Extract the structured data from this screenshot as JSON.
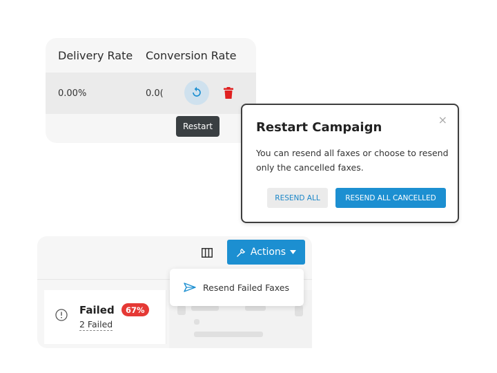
{
  "table": {
    "headers": [
      "Delivery Rate",
      "Conversion Rate"
    ],
    "row": {
      "delivery_rate": "0.00%",
      "conversion_rate": "0.0("
    },
    "restart_tooltip": "Restart",
    "icons": {
      "restart": "restart-icon",
      "delete": "trash-icon"
    },
    "delete_color": "#e02020"
  },
  "dialog": {
    "title": "Restart Campaign",
    "close": "×",
    "body": "You can resend all faxes or choose to resend only the cancelled faxes.",
    "buttons": {
      "resend_all": "RESEND ALL",
      "resend_all_cancelled": "RESEND ALL CANCELLED"
    },
    "accent_color": "#1c8fd1"
  },
  "toolbar": {
    "actions_label": "Actions",
    "icons": {
      "columns": "columns-icon",
      "actions": "tools-icon",
      "caret": "caret-down-icon"
    }
  },
  "dropdown": {
    "items": [
      {
        "label": "Resend Failed Faxes",
        "icon": "send-icon"
      }
    ]
  },
  "status_card": {
    "label": "Failed",
    "percentage": "67%",
    "count": "2 Failed",
    "badge_color": "#e53935",
    "icon": "alert-circle-icon"
  }
}
